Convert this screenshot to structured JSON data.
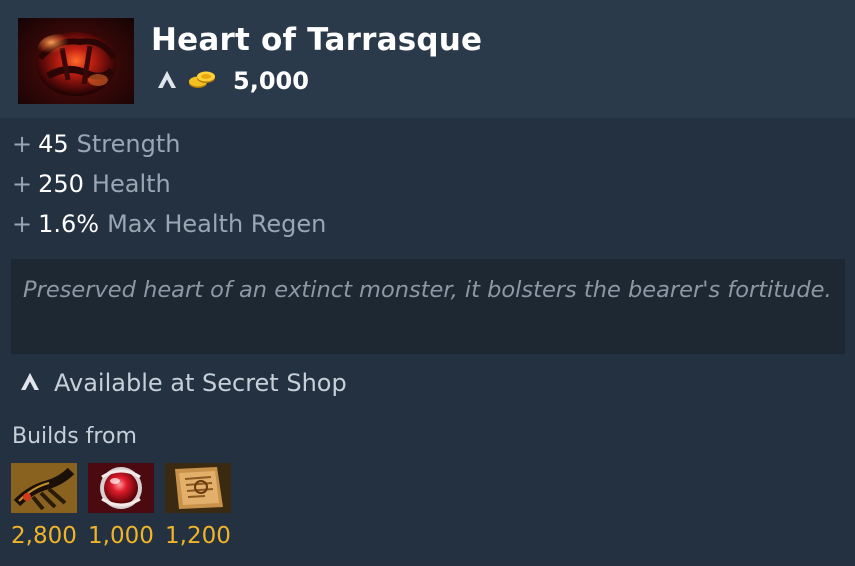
{
  "item": {
    "name": "Heart of Tarrasque",
    "icon": "heart-of-tarrasque-icon",
    "cost": "5,000",
    "shop_icon": "secret-shop-icon",
    "gold_icon": "gold-coins-icon"
  },
  "attributes": [
    {
      "plus": "+",
      "value": "45",
      "label": "Strength"
    },
    {
      "plus": "+",
      "value": "250",
      "label": "Health"
    },
    {
      "plus": "+",
      "value": "1.6%",
      "label": "Max Health Regen"
    }
  ],
  "lore": "Preserved heart of an extinct monster, it bolsters the bearer's fortitude.",
  "availability": {
    "icon": "secret-shop-icon",
    "text": "Available at Secret Shop"
  },
  "builds_from": {
    "label": "Builds from",
    "components": [
      {
        "icon": "claw-item-icon",
        "price": "2,800"
      },
      {
        "icon": "red-orb-item-icon",
        "price": "1,000"
      },
      {
        "icon": "recipe-scroll-icon",
        "price": "1,200"
      }
    ]
  },
  "colors": {
    "background": "#243140",
    "header": "#2b3a4a",
    "lore_background": "#1d2833",
    "gold": "#f0b429",
    "text_muted": "#9aa6b2",
    "text_bright": "#ffffff"
  }
}
